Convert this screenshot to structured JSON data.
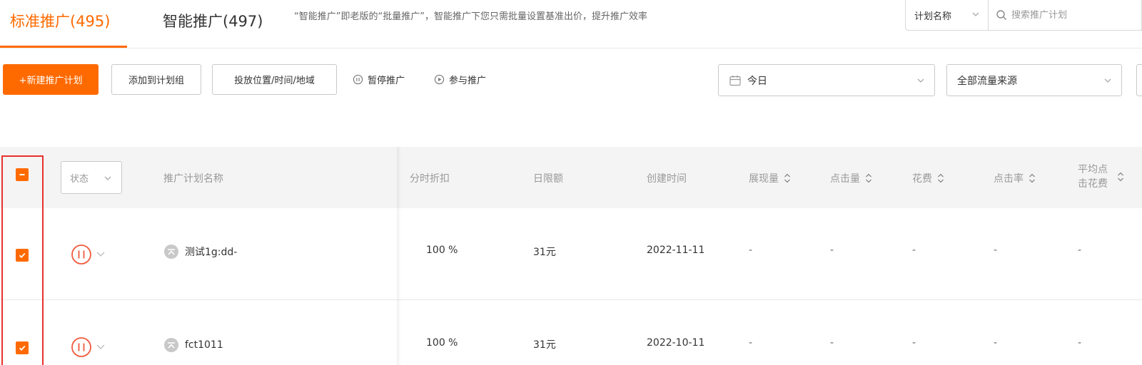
{
  "tabs": {
    "standard_label": "标准推广(495)",
    "smart_label": "智能推广(497)",
    "hint": "“智能推广”即老版的“批量推广”，智能推广下您只需批量设置基准出价，提升推广效率"
  },
  "search": {
    "field_label": "计划名称",
    "placeholder": "搜索推广计划"
  },
  "toolbar": {
    "new_plan": "+新建推广计划",
    "add_to_group": "添加到计划组",
    "placement": "投放位置/时间/地域",
    "pause": "暂停推广",
    "join": "参与推广"
  },
  "filters": {
    "date": "今日",
    "traffic_source": "全部流量来源"
  },
  "table": {
    "status_filter": "状态",
    "columns": {
      "name": "推广计划名称",
      "discount": "分时折扣",
      "daily_limit": "日限额",
      "created": "创建时间",
      "impressions": "展现量",
      "clicks": "点击量",
      "cost": "花费",
      "ctr": "点击率",
      "avg_cpc_line1": "平均点",
      "avg_cpc_line2": "击花费"
    },
    "rows": [
      {
        "name": "测试1g:dd-",
        "discount": "100 %",
        "daily_limit": "31元",
        "created": "2022-11-11",
        "impressions": "-",
        "clicks": "-",
        "cost": "-",
        "ctr": "-",
        "avg_cpc": "-"
      },
      {
        "name": "fct1011",
        "discount": "100 %",
        "daily_limit": "31元",
        "created": "2022-10-11",
        "impressions": "-",
        "clicks": "-",
        "cost": "-",
        "ctr": "-",
        "avg_cpc": "-"
      }
    ]
  },
  "colors": {
    "accent": "#ff6a00",
    "highlight_box": "#e8312f",
    "header_bg": "#f4f4f4"
  }
}
